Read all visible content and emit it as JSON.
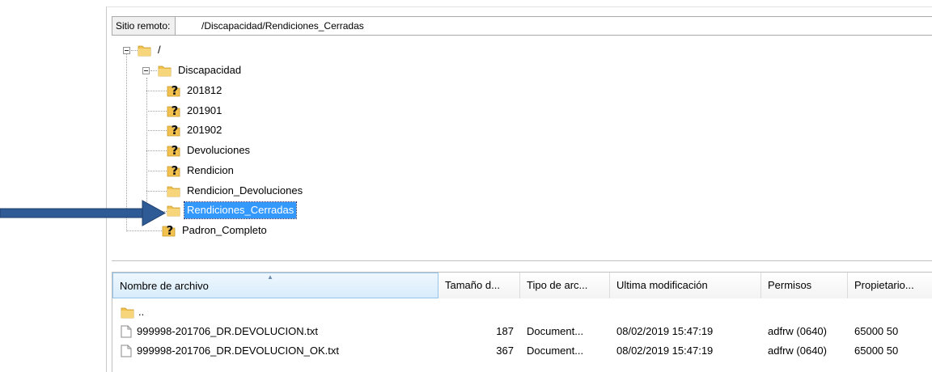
{
  "remote_site": {
    "label": "Sitio remoto:",
    "path": "/Discapacidad/Rendiciones_Cerradas"
  },
  "tree": {
    "root": {
      "label": "/"
    },
    "discapacidad": {
      "label": "Discapacidad"
    },
    "children": [
      {
        "label": "201812",
        "icon": "unknown-folder-icon"
      },
      {
        "label": "201901",
        "icon": "unknown-folder-icon"
      },
      {
        "label": "201902",
        "icon": "unknown-folder-icon"
      },
      {
        "label": "Devoluciones",
        "icon": "unknown-folder-icon"
      },
      {
        "label": "Rendicion",
        "icon": "unknown-folder-icon"
      },
      {
        "label": "Rendicion_Devoluciones",
        "icon": "folder-icon"
      },
      {
        "label": "Rendiciones_Cerradas",
        "icon": "folder-icon",
        "selected": true
      }
    ],
    "padron": {
      "label": "Padron_Completo",
      "icon": "unknown-folder-icon"
    }
  },
  "list": {
    "columns": [
      {
        "label": "Nombre de archivo",
        "sorted": true
      },
      {
        "label": "Tamaño d..."
      },
      {
        "label": "Tipo de arc..."
      },
      {
        "label": "Ultima modificación"
      },
      {
        "label": "Permisos"
      },
      {
        "label": "Propietario..."
      }
    ],
    "rows": [
      {
        "name": "..",
        "size": "",
        "type": "",
        "modified": "",
        "perms": "",
        "owner": "",
        "icon": "folder-icon"
      },
      {
        "name": "999998-201706_DR.DEVOLUCION.txt",
        "size": "187",
        "type": "Document...",
        "modified": "08/02/2019 15:47:19",
        "perms": "adfrw (0640)",
        "owner": "65000 50",
        "icon": "text-file-icon"
      },
      {
        "name": "999998-201706_DR.DEVOLUCION_OK.txt",
        "size": "367",
        "type": "Document...",
        "modified": "08/02/2019 15:47:19",
        "perms": "adfrw (0640)",
        "owner": "65000 50",
        "icon": "text-file-icon"
      }
    ]
  },
  "colors": {
    "selection": "#3399ff",
    "arrow": "#2e5a96",
    "folder": "#f2c14e",
    "header_sorted": "#d8ecfb"
  },
  "annotation": {
    "icon": "blue-arrow-icon"
  }
}
